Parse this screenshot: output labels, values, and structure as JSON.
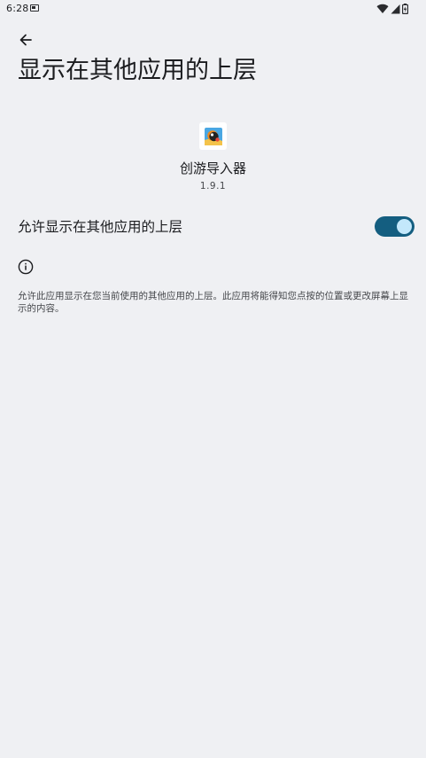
{
  "status_bar": {
    "time": "6:28",
    "icons": [
      "notification-icon",
      "wifi-icon",
      "signal-icon",
      "battery-icon"
    ]
  },
  "header": {
    "back_icon": "arrow-back-icon",
    "title": "显示在其他应用的上层"
  },
  "app": {
    "name": "创游导入器",
    "version": "1.9.1",
    "icon": "app-icon"
  },
  "permission": {
    "label": "允许显示在其他应用的上层",
    "enabled": true
  },
  "footer": {
    "icon": "info-icon",
    "text": "允许此应用显示在您当前使用的其他应用的上层。此应用将能得知您点按的位置或更改屏幕上显示的内容。"
  },
  "colors": {
    "background": "#eff0f3",
    "toggle_track": "#145e80",
    "toggle_thumb": "#c3e8fb",
    "text_primary": "#1b1c1f",
    "text_secondary": "#45474b"
  }
}
